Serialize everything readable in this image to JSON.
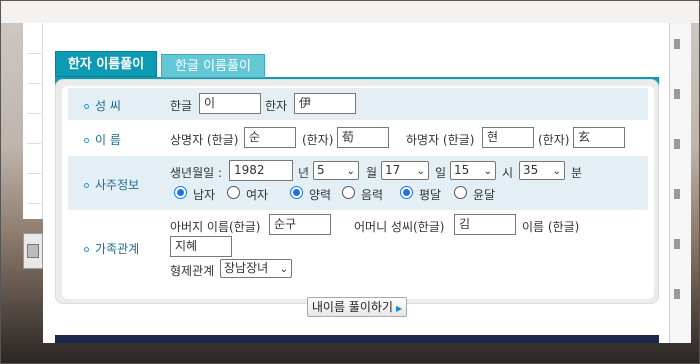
{
  "tabs": [
    {
      "label": "한자 이름풀이",
      "active": true
    },
    {
      "label": "한글 이름풀이",
      "active": false
    }
  ],
  "rows": {
    "surname": {
      "label": "성 씨",
      "hangul_label": "한글",
      "hangul_value": "이",
      "hanja_label": "한자",
      "hanja_value": "伊"
    },
    "name": {
      "label": "이 름",
      "upper_label": "상명자 (한글)",
      "upper_hangul": "순",
      "upper_hanja_label": "(한자)",
      "upper_hanja": "荀",
      "lower_label": "하명자 (한글)",
      "lower_hangul": "현",
      "lower_hanja_label": "(한자)",
      "lower_hanja": "玄"
    },
    "saju": {
      "label": "사주정보",
      "birth_label": "생년월일 :",
      "year": "1982",
      "year_unit": "년",
      "month": "5",
      "month_unit": "월",
      "day": "17",
      "day_unit": "일",
      "hour": "15",
      "hour_unit": "시",
      "minute": "35",
      "minute_unit": "분",
      "gender_options": [
        "남자",
        "여자"
      ],
      "gender_selected": "남자",
      "calendar_options": [
        "양력",
        "음력"
      ],
      "calendar_selected": "양력",
      "leap_options": [
        "평달",
        "윤달"
      ],
      "leap_selected": "평달"
    },
    "family": {
      "label": "가족관계",
      "father_label": "아버지 이름(한글)",
      "father_value": "순구",
      "mother_surname_label": "어머니 성씨(한글)",
      "mother_surname_value": "김",
      "mother_name_label": "이름 (한글)",
      "mother_name_value": "지혜",
      "sibling_label": "형제관계",
      "sibling_value": "장남장녀"
    }
  },
  "submit_label": "내이름 풀이하기",
  "colors": {
    "tab_active": "#0f9ab3",
    "tab_inactive": "#64c7d6",
    "row_shade": "#e3eff5",
    "label_text": "#1e6b8a"
  }
}
